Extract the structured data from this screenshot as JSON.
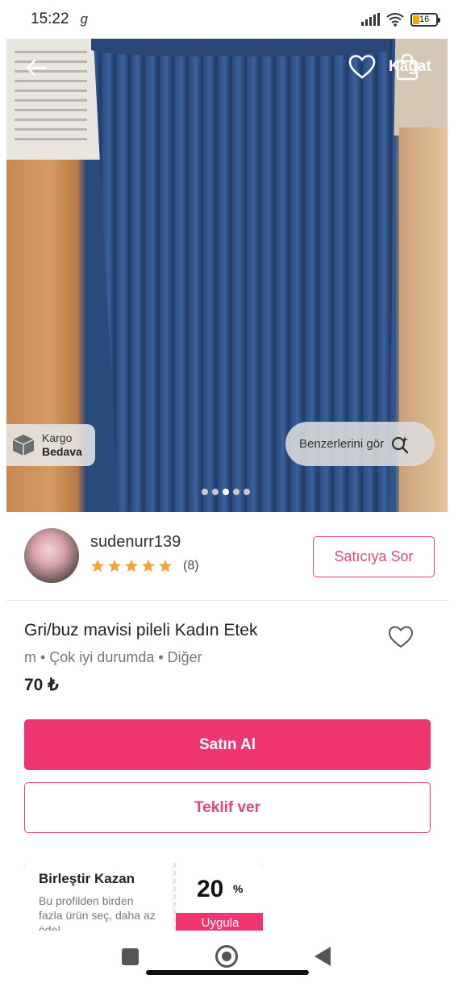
{
  "status_bar": {
    "time": "15:22",
    "carrier_glyph": "g",
    "battery": "16"
  },
  "header": {
    "cart_label": "Kağat"
  },
  "photo": {
    "shipping_label": "Kargo",
    "shipping_value": "Bedava",
    "similar_label": "Benzerlerini gör",
    "image_count": 5,
    "active_index": 2
  },
  "seller": {
    "username": "sudenurr139",
    "rating_stars": 5,
    "rating_count": "(8)",
    "ask_button": "Satıcıya Sor"
  },
  "product": {
    "title": "Gri/buz mavisi pileli Kadın Etek",
    "meta": "m • Çok iyi durumda • Diğer",
    "price": "70 ₺"
  },
  "actions": {
    "buy_label": "Satın Al",
    "offer_label": "Teklif ver"
  },
  "promo": {
    "title": "Birleştir Kazan",
    "description": "Bu profilden birden fazla ürün seç, daha az öde!",
    "percent": "20",
    "percent_sign": "%",
    "apply_label": "Uygula"
  },
  "colors": {
    "accent": "#ef3670",
    "accent_outline": "#e8447a",
    "star": "#f4a340"
  }
}
